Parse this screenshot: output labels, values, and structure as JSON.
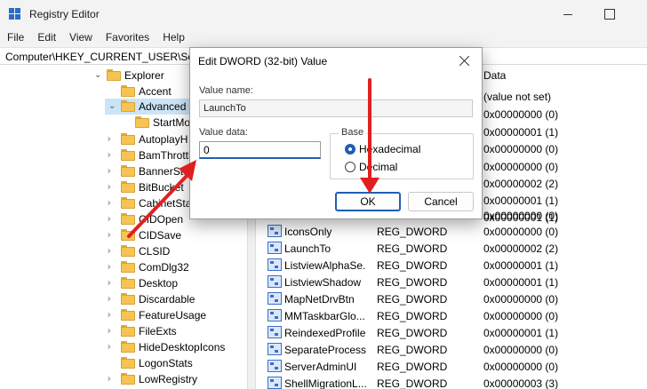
{
  "window": {
    "title": "Registry Editor"
  },
  "menu": [
    "File",
    "Edit",
    "View",
    "Favorites",
    "Help"
  ],
  "address": "Computer\\HKEY_CURRENT_USER\\Softw",
  "tree": [
    {
      "label": "Explorer",
      "expanded": true
    },
    {
      "label": "Accent"
    },
    {
      "label": "Advanced",
      "expanded": true,
      "selected": true
    },
    {
      "label": "StartMo"
    },
    {
      "label": "AutoplayH"
    },
    {
      "label": "BamThrottl"
    },
    {
      "label": "BannerSte"
    },
    {
      "label": "BitBucket"
    },
    {
      "label": "CabinetStat"
    },
    {
      "label": "CIDOpen"
    },
    {
      "label": "CIDSave"
    },
    {
      "label": "CLSID"
    },
    {
      "label": "ComDlg32"
    },
    {
      "label": "Desktop"
    },
    {
      "label": "Discardable"
    },
    {
      "label": "FeatureUsage"
    },
    {
      "label": "FileExts"
    },
    {
      "label": "HideDesktopIcons"
    },
    {
      "label": "LogonStats"
    },
    {
      "label": "LowRegistry"
    }
  ],
  "values_header": {
    "data": "Data"
  },
  "values_hidden": [
    {
      "data": "(value not set)"
    },
    {
      "data": "0x00000000 (0)"
    },
    {
      "data": "0x00000001 (1)"
    },
    {
      "data": "0x00000000 (0)"
    },
    {
      "data": "0x00000000 (0)"
    },
    {
      "data": "0x00000002 (2)"
    },
    {
      "data": "0x00000001 (1)"
    },
    {
      "data": "0x00000001 (1)"
    },
    {
      "data": "0x00000000 (0)"
    }
  ],
  "values": [
    {
      "name": "IconsOnly",
      "type": "REG_DWORD",
      "data": "0x00000000 (0)"
    },
    {
      "name": "LaunchTo",
      "type": "REG_DWORD",
      "data": "0x00000002 (2)"
    },
    {
      "name": "ListviewAlphaSe...",
      "type": "REG_DWORD",
      "data": "0x00000001 (1)"
    },
    {
      "name": "ListviewShadow",
      "type": "REG_DWORD",
      "data": "0x00000001 (1)"
    },
    {
      "name": "MapNetDrvBtn",
      "type": "REG_DWORD",
      "data": "0x00000000 (0)"
    },
    {
      "name": "MMTaskbarGlo...",
      "type": "REG_DWORD",
      "data": "0x00000000 (0)"
    },
    {
      "name": "ReindexedProfile",
      "type": "REG_DWORD",
      "data": "0x00000001 (1)"
    },
    {
      "name": "SeparateProcess",
      "type": "REG_DWORD",
      "data": "0x00000000 (0)"
    },
    {
      "name": "ServerAdminUI",
      "type": "REG_DWORD",
      "data": "0x00000000 (0)"
    },
    {
      "name": "ShellMigrationL...",
      "type": "REG_DWORD",
      "data": "0x00000003 (3)"
    }
  ],
  "dialog": {
    "title": "Edit DWORD (32-bit) Value",
    "value_name_label": "Value name:",
    "value_name": "LaunchTo",
    "value_data_label": "Value data:",
    "value_data": "0",
    "base_label": "Base",
    "base_options": [
      "Hexadecimal",
      "Decimal"
    ],
    "base_selected": "Hexadecimal",
    "ok_label": "OK",
    "cancel_label": "Cancel"
  },
  "colors": {
    "accent": "#1f5fb4",
    "annotation_arrow": "#e02020",
    "selection": "#cce4f7"
  }
}
